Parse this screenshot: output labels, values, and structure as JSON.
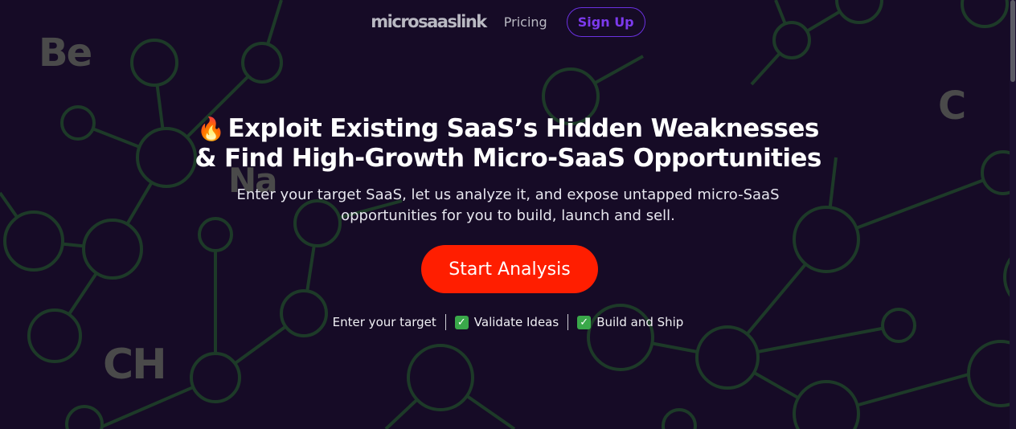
{
  "nav": {
    "logo": "microsaaslink",
    "pricing": "Pricing",
    "signup": "Sign Up"
  },
  "background_labels": [
    "Be",
    "C",
    "Na",
    "CH"
  ],
  "hero": {
    "line1": "Exploit Existing SaaS’s Hidden Weaknesses",
    "line2": "& Find High-Growth Micro-SaaS Opportunities",
    "sub1": "Enter your target SaaS, let us analyze it, and expose untapped micro-SaaS",
    "sub2": "opportunities for you to build, launch and sell.",
    "cta": "Start Analysis"
  },
  "steps": {
    "step1": "Enter your target",
    "step2": "Validate Ideas",
    "step3": "Build and Ship"
  },
  "colors": {
    "background": "#160b26",
    "accent_purple": "#7c3aed",
    "cta_red": "#ff1e00",
    "network_lines": "#1f3a2a"
  }
}
